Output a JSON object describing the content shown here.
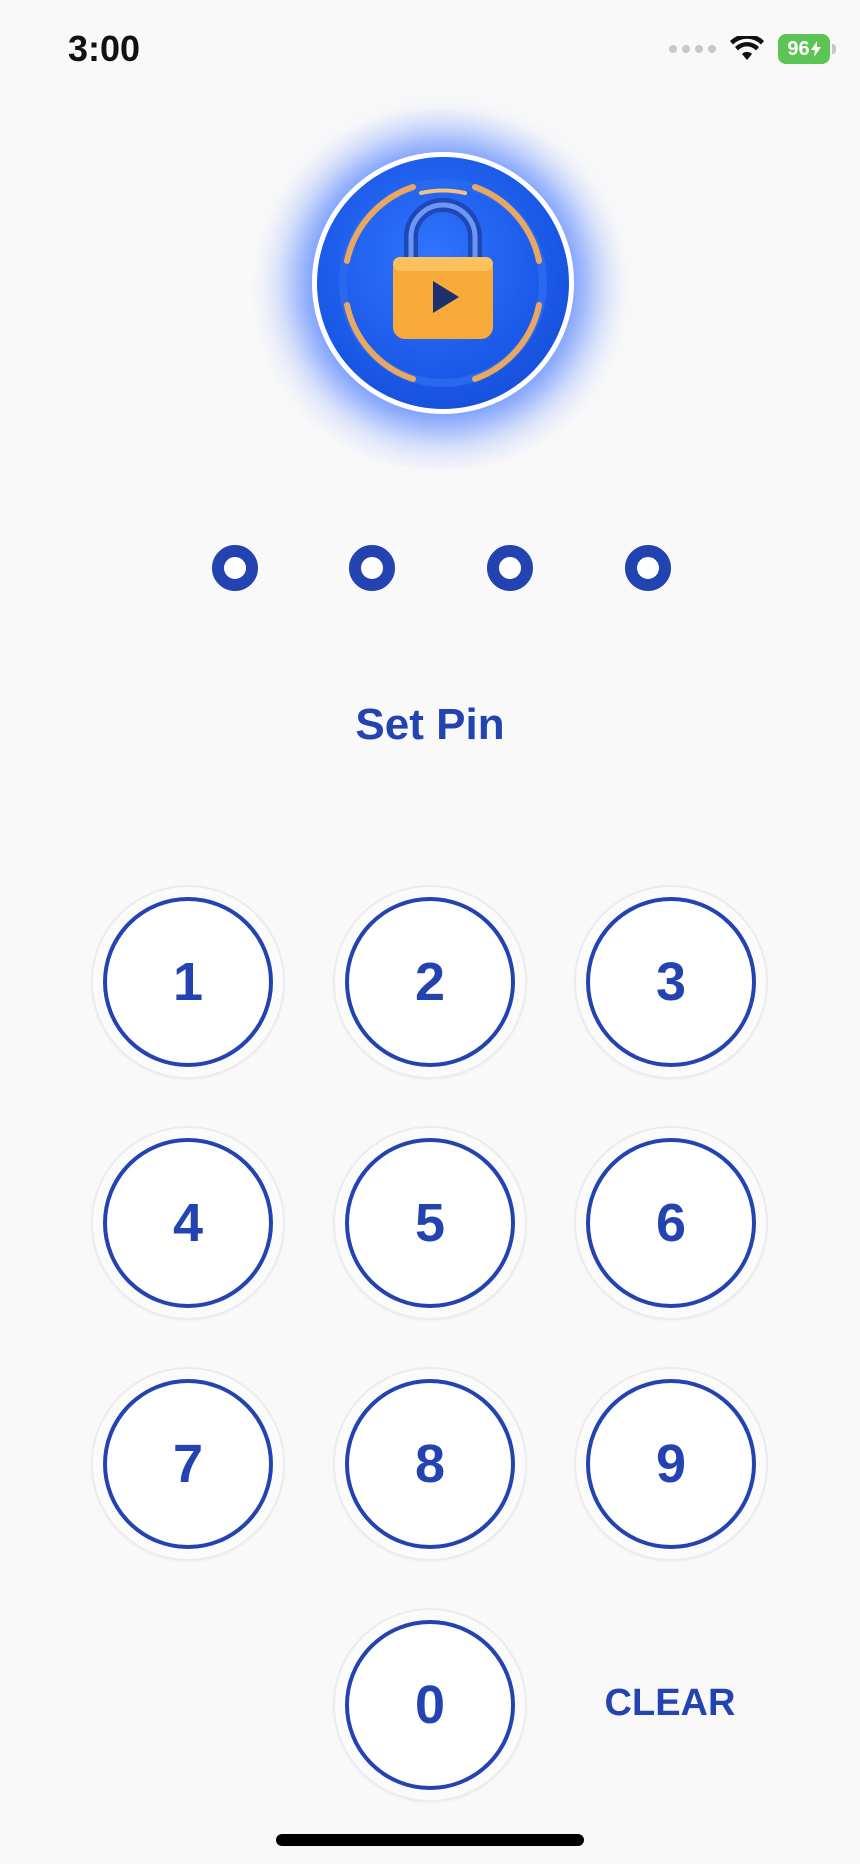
{
  "status_bar": {
    "time": "3:00",
    "battery": "96",
    "icons": [
      "signal-icon",
      "wifi-icon",
      "battery-icon"
    ]
  },
  "logo": {
    "icon": "lock-play-icon",
    "colors": {
      "primary": "#1a58e6",
      "lock": "#f7a93a",
      "ring": "#e8a862"
    }
  },
  "pin": {
    "length": 4,
    "filled": 0
  },
  "title": "Set Pin",
  "keypad": {
    "keys": [
      "1",
      "2",
      "3",
      "4",
      "5",
      "6",
      "7",
      "8",
      "9",
      "0"
    ],
    "clear_label": "CLEAR"
  },
  "colors": {
    "accent": "#2343b0",
    "background": "#f9f9f9"
  }
}
